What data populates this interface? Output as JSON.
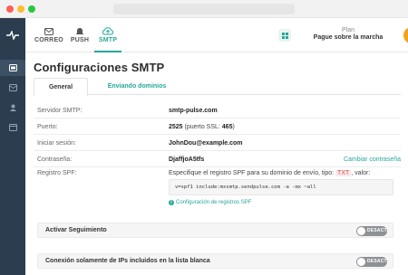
{
  "nav": {
    "tabs": [
      {
        "label": "CORREO"
      },
      {
        "label": "PUSH"
      },
      {
        "label": "SMTP"
      }
    ],
    "plan_title": "Plan",
    "plan_subtitle": "Pague sobre la marcha"
  },
  "page": {
    "title": "Configuraciones SMTP",
    "tabs": [
      {
        "label": "General"
      },
      {
        "label": "Enviando dominios"
      }
    ]
  },
  "settings": {
    "server": {
      "label": "Servidor SMTP:",
      "value": "smtp-pulse.com"
    },
    "port": {
      "label": "Puerto:",
      "value": "2525",
      "ssl_prefix": "(puerto SSL: ",
      "ssl_value": "465",
      "ssl_suffix": ")"
    },
    "login": {
      "label": "Iniciar sesión:",
      "value": "JohnDou@example.com"
    },
    "password": {
      "label": "Contraseña:",
      "value": "DjaffjoA5tfs",
      "change_link": "Cambiar contraseña"
    },
    "spf": {
      "label": "Registro SPF:",
      "desc_before": "Especifique el registro SPF para su dominio de envío, tipo: ",
      "type": "TXT",
      "desc_after": ", valor:",
      "code": "v=spf1 include:mxsmtp.sendpulse.com -a -mx ~all",
      "help_link": "Configuración de registros SPF"
    }
  },
  "toggles": [
    {
      "label": "Activar Seguimiento",
      "state": "DESACT."
    },
    {
      "label": "Conexión solamente de IPs incluidos en la lista blanca",
      "state": "DESACT."
    }
  ],
  "colors": {
    "accent": "#26a69a",
    "rail": "#2b3d4f"
  }
}
